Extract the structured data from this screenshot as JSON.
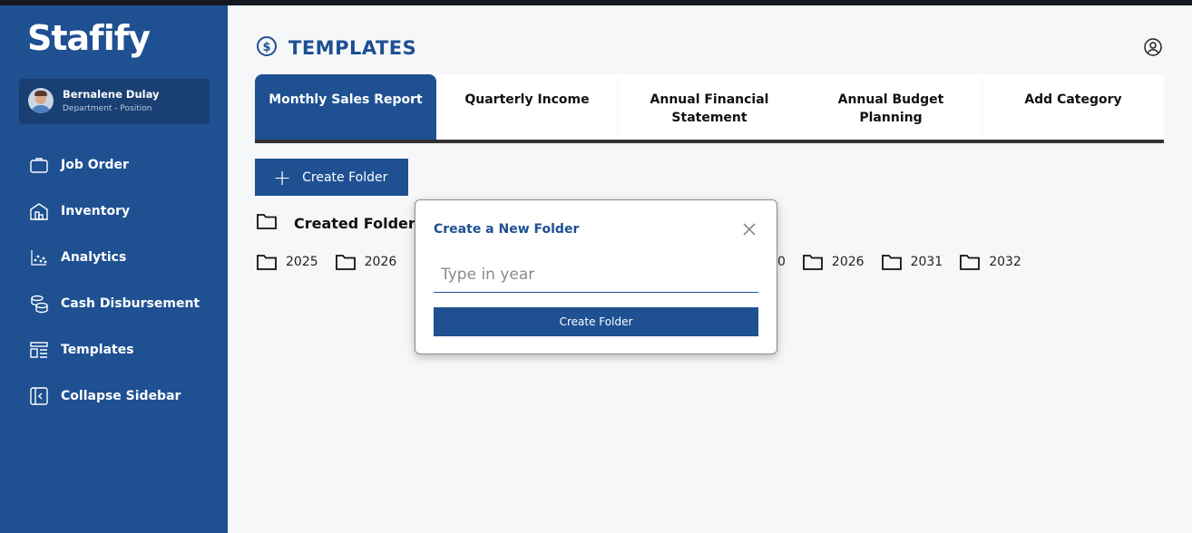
{
  "app": {
    "logo": "Stafify"
  },
  "user": {
    "name": "Bernalene Dulay",
    "role": "Department - Position"
  },
  "sidebar": {
    "items": [
      {
        "label": "Job Order",
        "icon": "briefcase-icon"
      },
      {
        "label": "Inventory",
        "icon": "warehouse-icon"
      },
      {
        "label": "Analytics",
        "icon": "scatter-chart-icon"
      },
      {
        "label": "Cash Disbursement",
        "icon": "coins-icon"
      },
      {
        "label": "Templates",
        "icon": "layout-template-icon"
      },
      {
        "label": "Collapse Sidebar",
        "icon": "collapse-sidebar-icon"
      }
    ]
  },
  "header": {
    "title": "TEMPLATES",
    "icon": "dollar-circle-icon",
    "account_icon": "user-circle-icon"
  },
  "tabs": [
    {
      "label": "Monthly Sales Report",
      "active": true
    },
    {
      "label": "Quarterly Income",
      "active": false
    },
    {
      "label": "Annual Financial Statement",
      "active": false
    },
    {
      "label": "Annual Budget Planning",
      "active": false
    },
    {
      "label": "Add Category",
      "active": false
    }
  ],
  "toolbar": {
    "create_folder_label": "Create Folder"
  },
  "created_folders": {
    "title": "Created Folder",
    "left_folders": [
      "2025",
      "2026"
    ],
    "right_folders": [
      "0",
      "2026",
      "2031",
      "2032"
    ]
  },
  "modal": {
    "title": "Create a New Folder",
    "input_placeholder": "Type in year",
    "input_value": "",
    "submit_label": "Create Folder"
  },
  "colors": {
    "primary": "#1e5092",
    "sidebar_card": "#1a3f72",
    "background": "#f6f7f9"
  }
}
